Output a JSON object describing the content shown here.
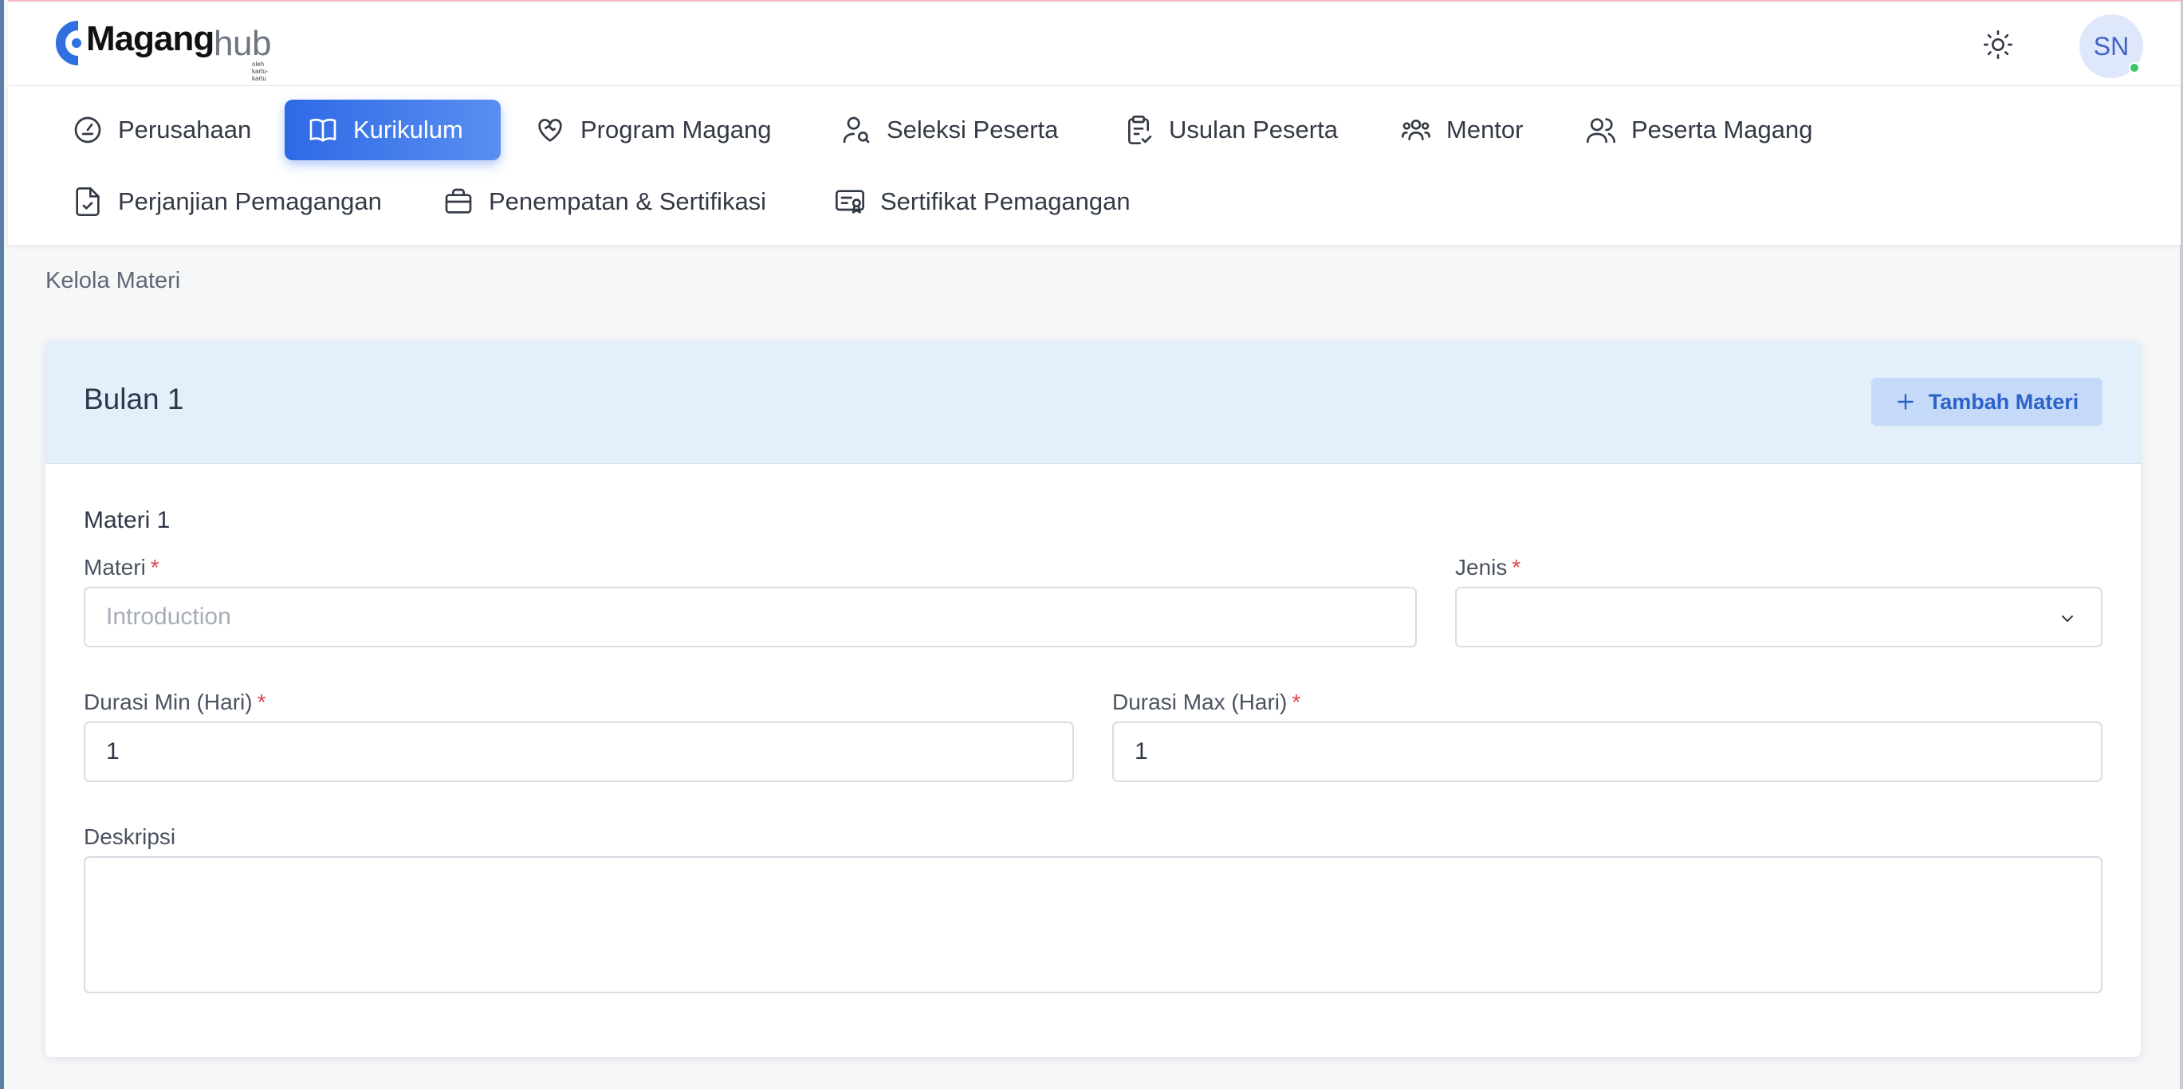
{
  "brand": {
    "name_bold": "Magang",
    "name_light": "hub",
    "subtitle": "oleh kartu-kartu",
    "accent": "#2f6fe0"
  },
  "header": {
    "theme_toggle_icon": "sun-icon",
    "avatar_initials": "SN",
    "online_color": "#3ec66d"
  },
  "nav": {
    "items": [
      {
        "label": "Perusahaan",
        "icon": "gauge-icon",
        "active": false
      },
      {
        "label": "Kurikulum",
        "icon": "book-open-icon",
        "active": true
      },
      {
        "label": "Program Magang",
        "icon": "heart-handshake-icon",
        "active": false
      },
      {
        "label": "Seleksi Peserta",
        "icon": "user-search-icon",
        "active": false
      },
      {
        "label": "Usulan Peserta",
        "icon": "clipboard-check-icon",
        "active": false
      },
      {
        "label": "Mentor",
        "icon": "users-icon",
        "active": false
      },
      {
        "label": "Peserta Magang",
        "icon": "user-group-icon",
        "active": false
      },
      {
        "label": "Perjanjian Pemagangan",
        "icon": "file-check-icon",
        "active": false
      },
      {
        "label": "Penempatan & Sertifikasi",
        "icon": "briefcase-icon",
        "active": false
      },
      {
        "label": "Sertifikat Pemagangan",
        "icon": "certificate-icon",
        "active": false
      }
    ]
  },
  "breadcrumb": "Kelola Materi",
  "card": {
    "title": "Bulan 1",
    "add_button": "Tambah Materi",
    "section_title": "Materi 1",
    "fields": {
      "materi": {
        "label": "Materi",
        "required": "*",
        "placeholder": "Introduction",
        "value": ""
      },
      "jenis": {
        "label": "Jenis",
        "required": "*",
        "value": ""
      },
      "durasi_min": {
        "label": "Durasi Min (Hari)",
        "required": "*",
        "value": "1"
      },
      "durasi_max": {
        "label": "Durasi Max (Hari)",
        "required": "*",
        "value": "1"
      },
      "deskripsi": {
        "label": "Deskripsi",
        "value": ""
      }
    }
  }
}
